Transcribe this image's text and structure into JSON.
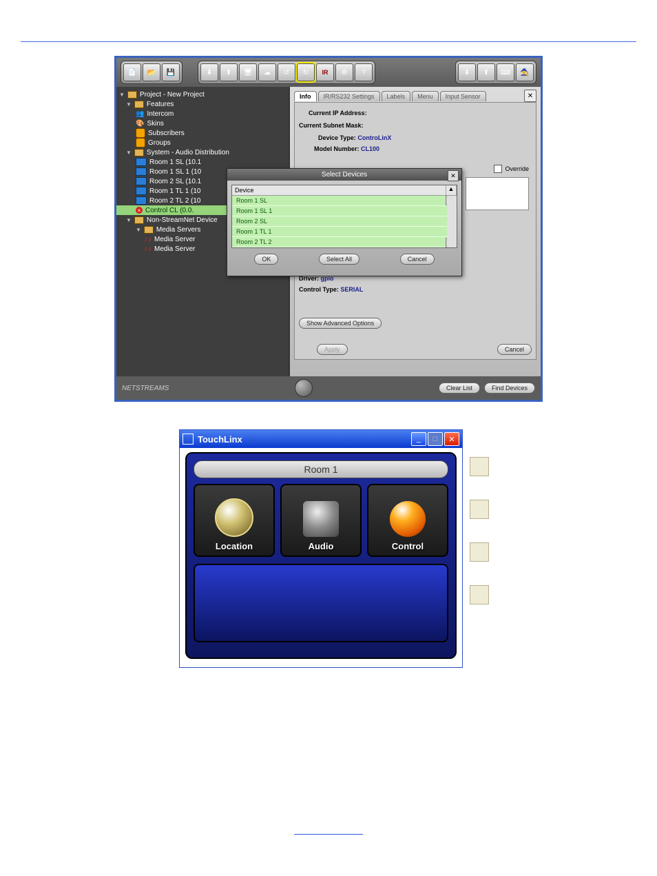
{
  "app1": {
    "tree": {
      "root": "Project - New Project",
      "features": {
        "label": "Features",
        "items": [
          "Intercom",
          "Skins",
          "Subscribers",
          "Groups"
        ]
      },
      "system": {
        "label": "System - Audio Distribution",
        "devices": [
          "Room 1 SL (10.1",
          "Room 1 SL 1 (10",
          "Room 2 SL (10.1",
          "Room 1 TL 1 (10",
          "Room 2 TL 2 (10",
          "Control CL (0.0."
        ]
      },
      "nonstream": {
        "label": "Non-StreamNet Device",
        "media_label": "Media Servers",
        "servers": [
          "Media Server",
          "Media Server"
        ]
      }
    },
    "tabs": [
      "Info",
      "IR/RS232 Settings",
      "Labels",
      "Menu",
      "Input Sensor"
    ],
    "info": {
      "ip_label": "Current IP Address:",
      "subnet_label": "Current Subnet Mask:",
      "device_type_label": "Device Type:",
      "device_type_value": "ControLinX",
      "model_label": "Model Number:",
      "model_value": "CL100",
      "override_label": "Override",
      "driver_label": "Driver:",
      "driver_value": "gpio",
      "control_type_label": "Control Type:",
      "control_type_value": "SERIAL",
      "advanced_btn": "Show Advanced Options",
      "apply_btn": "Apply",
      "cancel_btn": "Cancel"
    },
    "footer": {
      "logo": "NETSTREAMS",
      "clear_btn": "Clear List",
      "find_btn": "Find Devices"
    },
    "modal": {
      "title": "Select Devices",
      "header": "Device",
      "rows": [
        "Room 1 SL",
        "Room 1 SL 1",
        "Room 2 SL",
        "Room 1 TL 1",
        "Room 2 TL 2"
      ],
      "ok": "OK",
      "select_all": "Select All",
      "cancel": "Cancel"
    }
  },
  "app2": {
    "title": "TouchLinx",
    "room": "Room 1",
    "tiles": {
      "location": "Location",
      "audio": "Audio",
      "control": "Control"
    }
  }
}
